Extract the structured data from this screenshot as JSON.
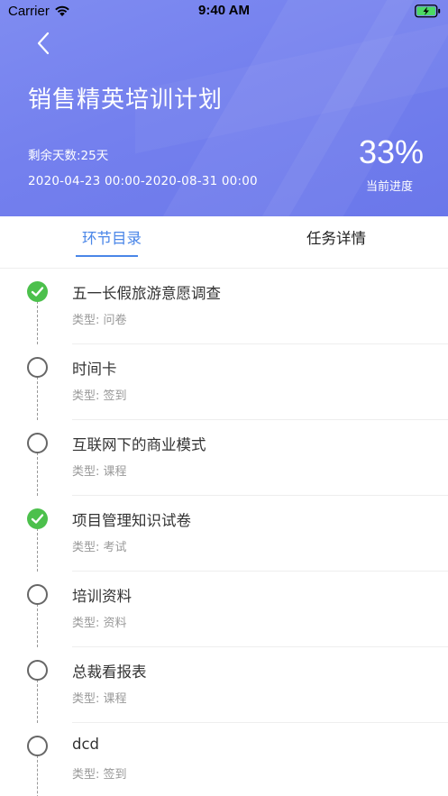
{
  "status_bar": {
    "carrier": "Carrier",
    "time": "9:40 AM"
  },
  "header": {
    "title": "销售精英培训计划",
    "days_left": "剩余天数:25天",
    "date_range": "2020-04-23 00:00-2020-08-31 00:00",
    "progress_value": "33%",
    "progress_label": "当前进度",
    "gradient_colors": [
      "#7f8cf1",
      "#6a77ea"
    ]
  },
  "tabs": [
    {
      "label": "环节目录",
      "active": true
    },
    {
      "label": "任务详情",
      "active": false
    }
  ],
  "colors": {
    "accent": "#4a86e8",
    "done": "#4cc04c"
  },
  "items": [
    {
      "name": "五一长假旅游意愿调查",
      "type": "类型: 问卷",
      "done": true
    },
    {
      "name": "时间卡",
      "type": "类型: 签到",
      "done": false
    },
    {
      "name": "互联网下的商业模式",
      "type": "类型: 课程",
      "done": false
    },
    {
      "name": "项目管理知识试卷",
      "type": "类型: 考试",
      "done": true
    },
    {
      "name": "培训资料",
      "type": "类型: 资料",
      "done": false
    },
    {
      "name": "总裁看报表",
      "type": "类型: 课程",
      "done": false
    },
    {
      "name": "dcd",
      "type": "类型: 签到",
      "done": false
    }
  ]
}
